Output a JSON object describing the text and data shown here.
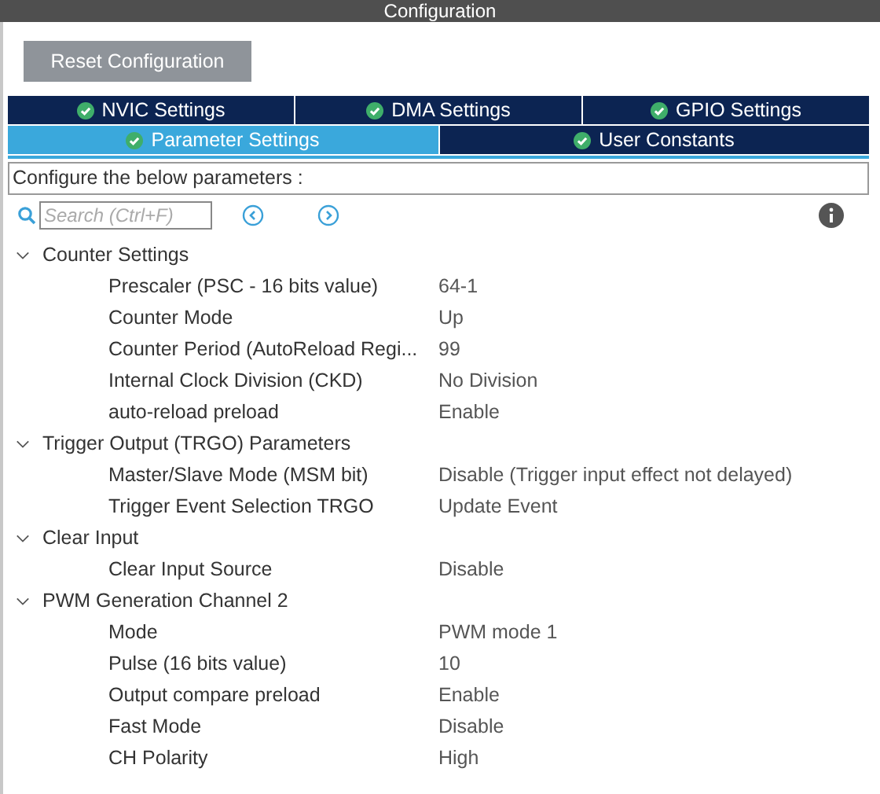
{
  "window": {
    "title": "Configuration"
  },
  "reset_button": "Reset Configuration",
  "tab_rows": [
    [
      {
        "label": "NVIC Settings",
        "selected": false
      },
      {
        "label": "DMA Settings",
        "selected": false
      },
      {
        "label": "GPIO Settings",
        "selected": false
      }
    ],
    [
      {
        "label": "Parameter Settings",
        "selected": true
      },
      {
        "label": "User Constants",
        "selected": false
      }
    ]
  ],
  "instruction": "Configure the below parameters :",
  "search": {
    "placeholder": "Search (Ctrl+F)"
  },
  "tree": [
    {
      "label": "Counter Settings",
      "expanded": true,
      "children": [
        {
          "label": "Prescaler (PSC - 16 bits value)",
          "value": "64-1"
        },
        {
          "label": "Counter Mode",
          "value": "Up"
        },
        {
          "label": "Counter Period (AutoReload Regi...",
          "value": "99"
        },
        {
          "label": "Internal Clock Division (CKD)",
          "value": "No Division"
        },
        {
          "label": "auto-reload preload",
          "value": "Enable"
        }
      ]
    },
    {
      "label": "Trigger Output (TRGO) Parameters",
      "expanded": true,
      "children": [
        {
          "label": "Master/Slave Mode (MSM bit)",
          "value": "Disable (Trigger input effect not delayed)"
        },
        {
          "label": "Trigger Event Selection TRGO",
          "value": "Update Event"
        }
      ]
    },
    {
      "label": "Clear Input",
      "expanded": true,
      "children": [
        {
          "label": "Clear Input Source",
          "value": "Disable"
        }
      ]
    },
    {
      "label": "PWM Generation Channel 2",
      "expanded": true,
      "children": [
        {
          "label": "Mode",
          "value": "PWM mode 1"
        },
        {
          "label": "Pulse (16 bits value)",
          "value": "10"
        },
        {
          "label": "Output compare preload",
          "value": "Enable"
        },
        {
          "label": "Fast Mode",
          "value": "Disable"
        },
        {
          "label": "CH Polarity",
          "value": "High"
        }
      ]
    }
  ]
}
